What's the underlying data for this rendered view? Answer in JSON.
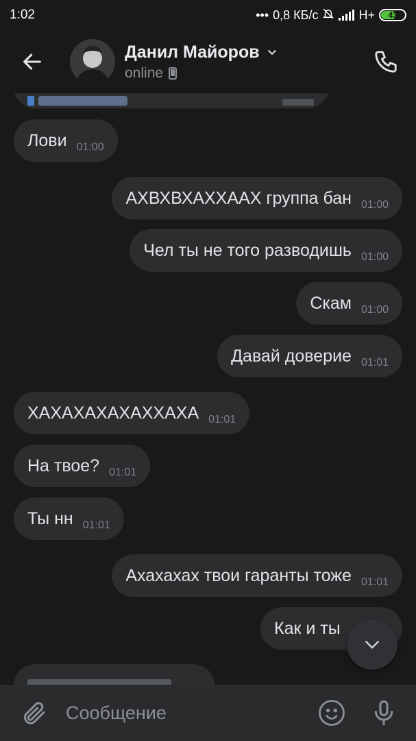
{
  "status_bar": {
    "time": "1:02",
    "network_speed": "0,8 КБ/с",
    "network_type": "H+",
    "battery": "43"
  },
  "header": {
    "contact_name": "Данил Майоров",
    "status": "online"
  },
  "messages": [
    {
      "dir": "in",
      "text": "Лови",
      "time": "01:00"
    },
    {
      "dir": "out",
      "text": "АХВХВХАХХААХ группа бан",
      "time": "01:00"
    },
    {
      "dir": "out",
      "text": "Чел ты не того разводишь",
      "time": "01:00"
    },
    {
      "dir": "out",
      "text": "Скам",
      "time": "01:00"
    },
    {
      "dir": "out",
      "text": "Давай доверие",
      "time": "01:01"
    },
    {
      "dir": "in",
      "text": "ХАХАХАХАХАХХАХА",
      "time": "01:01"
    },
    {
      "dir": "in",
      "text": "На твое?",
      "time": "01:01"
    },
    {
      "dir": "in",
      "text": "Ты нн",
      "time": "01:01"
    },
    {
      "dir": "out",
      "text": "Ахахахах твои гаранты тоже",
      "time": "01:01"
    },
    {
      "dir": "out",
      "text": "Как и ты",
      "time": ""
    }
  ],
  "composer": {
    "placeholder": "Сообщение"
  },
  "colors": {
    "background": "#191919",
    "bubble": "#2c2d2f",
    "composer": "#2a2b2d",
    "battery_green": "#53c33d"
  }
}
